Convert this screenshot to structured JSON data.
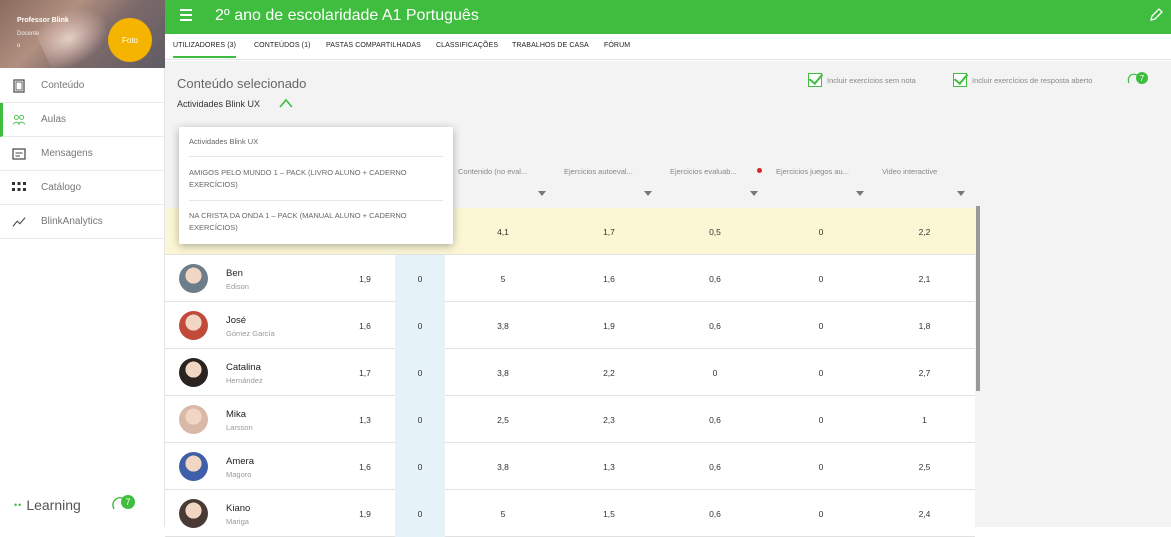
{
  "sidebar": {
    "profile": {
      "name": "Professor Blink",
      "role": "Docente",
      "extra": "o",
      "badge_text": "Foto"
    },
    "items": [
      {
        "label": "Conteúdo",
        "icon": "page-icon",
        "active": false
      },
      {
        "label": "Aulas",
        "icon": "group-icon",
        "active": true
      },
      {
        "label": "Mensagens",
        "icon": "message-icon",
        "active": false
      },
      {
        "label": "Catálogo",
        "icon": "grid-icon",
        "active": false
      },
      {
        "label": "BlinkAnalytics",
        "icon": "analytics-icon",
        "active": false
      }
    ],
    "brand": {
      "dots": "••",
      "name": "Learning",
      "help_count": "7"
    }
  },
  "header": {
    "title": "2º ano de escolaridade A1 Português",
    "bg_color": "#3ebd3e"
  },
  "tabs": [
    {
      "label": "UTILIZADORES (3)",
      "active": true
    },
    {
      "label": "CONTEÚDOS (1)",
      "active": false
    },
    {
      "label": "PASTAS COMPARTILHADAS",
      "active": false
    },
    {
      "label": "CLASSIFICAÇÕES",
      "active": false
    },
    {
      "label": "TRABALHOS DE CASA",
      "active": false
    },
    {
      "label": "FÓRUM",
      "active": false
    }
  ],
  "content": {
    "section_title": "Conteúdo selecionado",
    "selected": "Actividades Blink UX",
    "options": [
      {
        "label": "Incluir exercícios sem nota",
        "checked": true
      },
      {
        "label": "Incluir exercícios de resposta aberto",
        "checked": true
      }
    ],
    "help_count": "7"
  },
  "dropdown": {
    "items": [
      "Actividades Blink UX",
      "AMIGOS PELO MUNDO 1 – PACK (LIVRO ALUNO + CADERNO EXERCÍCIOS)",
      "NA CRISTA DA ONDA 1 – PACK (MANUAL ALUNO + CADERNO EXERCÍCIOS)"
    ]
  },
  "table": {
    "columns": [
      {
        "label": "Contenido (no eval...",
        "dot": false
      },
      {
        "label": "Ejercicios autoeval...",
        "dot": false
      },
      {
        "label": "Ejercicios evaluab...",
        "dot": true
      },
      {
        "label": "Ejercicios juegos au...",
        "dot": false
      },
      {
        "label": "Video interactive",
        "dot": false
      }
    ],
    "average_row": [
      "4,1",
      "1,7",
      "0,5",
      "0",
      "2,2"
    ],
    "students": [
      {
        "first": "Ben",
        "last": "Edison",
        "avg": "1,9",
        "col0": "0",
        "vals": [
          "5",
          "1,6",
          "0,6",
          "0",
          "2,1"
        ],
        "avatar_color": "#6d7d8a"
      },
      {
        "first": "José",
        "last": "Gómez García",
        "avg": "1,6",
        "col0": "0",
        "vals": [
          "3,8",
          "1,9",
          "0,6",
          "0",
          "1,8"
        ],
        "avatar_color": "#c24a3a"
      },
      {
        "first": "Catalina",
        "last": "Hernández",
        "avg": "1,7",
        "col0": "0",
        "vals": [
          "3,8",
          "2,2",
          "0",
          "0",
          "2,7"
        ],
        "avatar_color": "#2b2320"
      },
      {
        "first": "Mika",
        "last": "Larsson",
        "avg": "1,3",
        "col0": "0",
        "vals": [
          "2,5",
          "2,3",
          "0,6",
          "0",
          "1"
        ],
        "avatar_color": "#d9b8a8"
      },
      {
        "first": "Amera",
        "last": "Magoro",
        "avg": "1,6",
        "col0": "0",
        "vals": [
          "3,8",
          "1,3",
          "0,6",
          "0",
          "2,5"
        ],
        "avatar_color": "#3f5fa8"
      },
      {
        "first": "Kiano",
        "last": "Mariga",
        "avg": "1,9",
        "col0": "0",
        "vals": [
          "5",
          "1,5",
          "0,6",
          "0",
          "2,4"
        ],
        "avatar_color": "#4a3a36"
      }
    ]
  }
}
